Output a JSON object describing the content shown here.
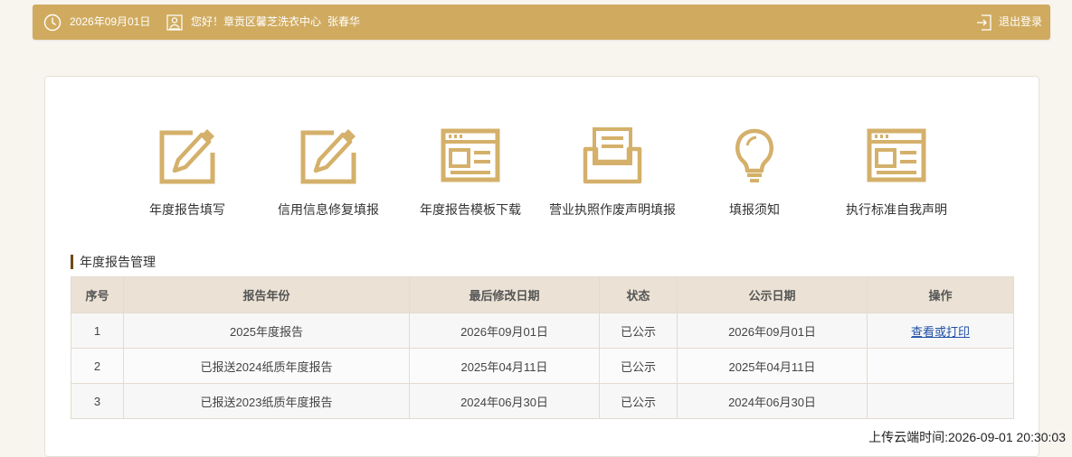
{
  "topbar": {
    "date": "2026年09月01日",
    "greeting": "您好！章贡区馨芝洗衣中心",
    "user_name": "张春华",
    "logout_label": "退出登录",
    "date_icon": "clock-icon",
    "user_icon": "user-badge-icon",
    "logout_icon": "logout-icon"
  },
  "functions": [
    {
      "label": "年度报告填写",
      "icon": "edit-document-icon"
    },
    {
      "label": "信用信息修复填报",
      "icon": "edit-document-icon"
    },
    {
      "label": "年度报告模板下载",
      "icon": "template-icon"
    },
    {
      "label": "营业执照作废声明填报",
      "icon": "inbox-document-icon"
    },
    {
      "label": "填报须知",
      "icon": "lightbulb-icon"
    },
    {
      "label": "执行标准自我声明",
      "icon": "template-icon"
    }
  ],
  "section": {
    "title": "年度报告管理"
  },
  "table": {
    "headers": [
      "序号",
      "报告年份",
      "最后修改日期",
      "状态",
      "公示日期",
      "操作"
    ],
    "rows": [
      [
        "1",
        "2025年度报告",
        "2026年09月01日",
        "已公示",
        "2026年09月01日",
        "查看或打印"
      ],
      [
        "2",
        "已报送2024纸质年度报告",
        "2025年04月11日",
        "已公示",
        "2025年04月11日",
        ""
      ],
      [
        "3",
        "已报送2023纸质年度报告",
        "2024年06月30日",
        "已公示",
        "2024年06月30日",
        ""
      ]
    ]
  },
  "footer": {
    "upload_time": "上传云端时间:2026-09-01 20:30:03"
  },
  "colors": {
    "accent": "#d0ab5f",
    "icon": "#d4b06a",
    "section_bar": "#6e4a14",
    "link": "#1f4fa7",
    "header_bg": "#ebe2d5"
  }
}
